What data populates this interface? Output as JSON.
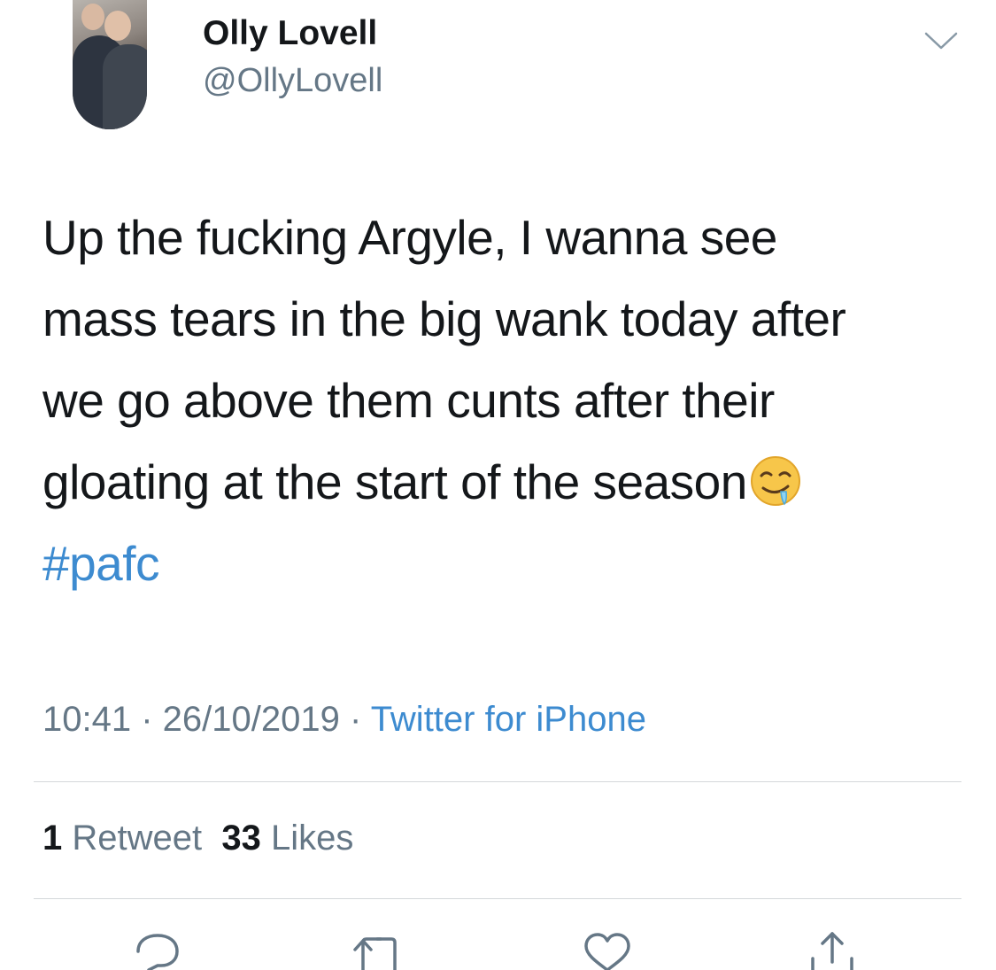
{
  "author": {
    "name": "Olly Lovell",
    "handle": "@OllyLovell"
  },
  "tweet": {
    "lines": [
      "Up the fucking Argyle, I wanna see",
      "mass tears in the big wank today after",
      "we go above them cunts after their",
      "gloating at the start of the season"
    ],
    "hashtag": "#pafc",
    "emoji": "drooling-face-emoji"
  },
  "meta": {
    "time": "10:41",
    "separator1": " · ",
    "date": "26/10/2019",
    "separator2": " · ",
    "source": "Twitter for iPhone"
  },
  "stats": {
    "retweets_count": "1",
    "retweets_label": "Retweet",
    "likes_count": "33",
    "likes_label": "Likes"
  },
  "actions": {
    "reply_icon": "reply-icon",
    "retweet_icon": "retweet-icon",
    "like_icon": "like-icon",
    "share_icon": "share-icon"
  },
  "colors": {
    "text": "#14171a",
    "secondary": "#657786",
    "link": "#3d8bd0",
    "divider": "#d4d7da"
  }
}
